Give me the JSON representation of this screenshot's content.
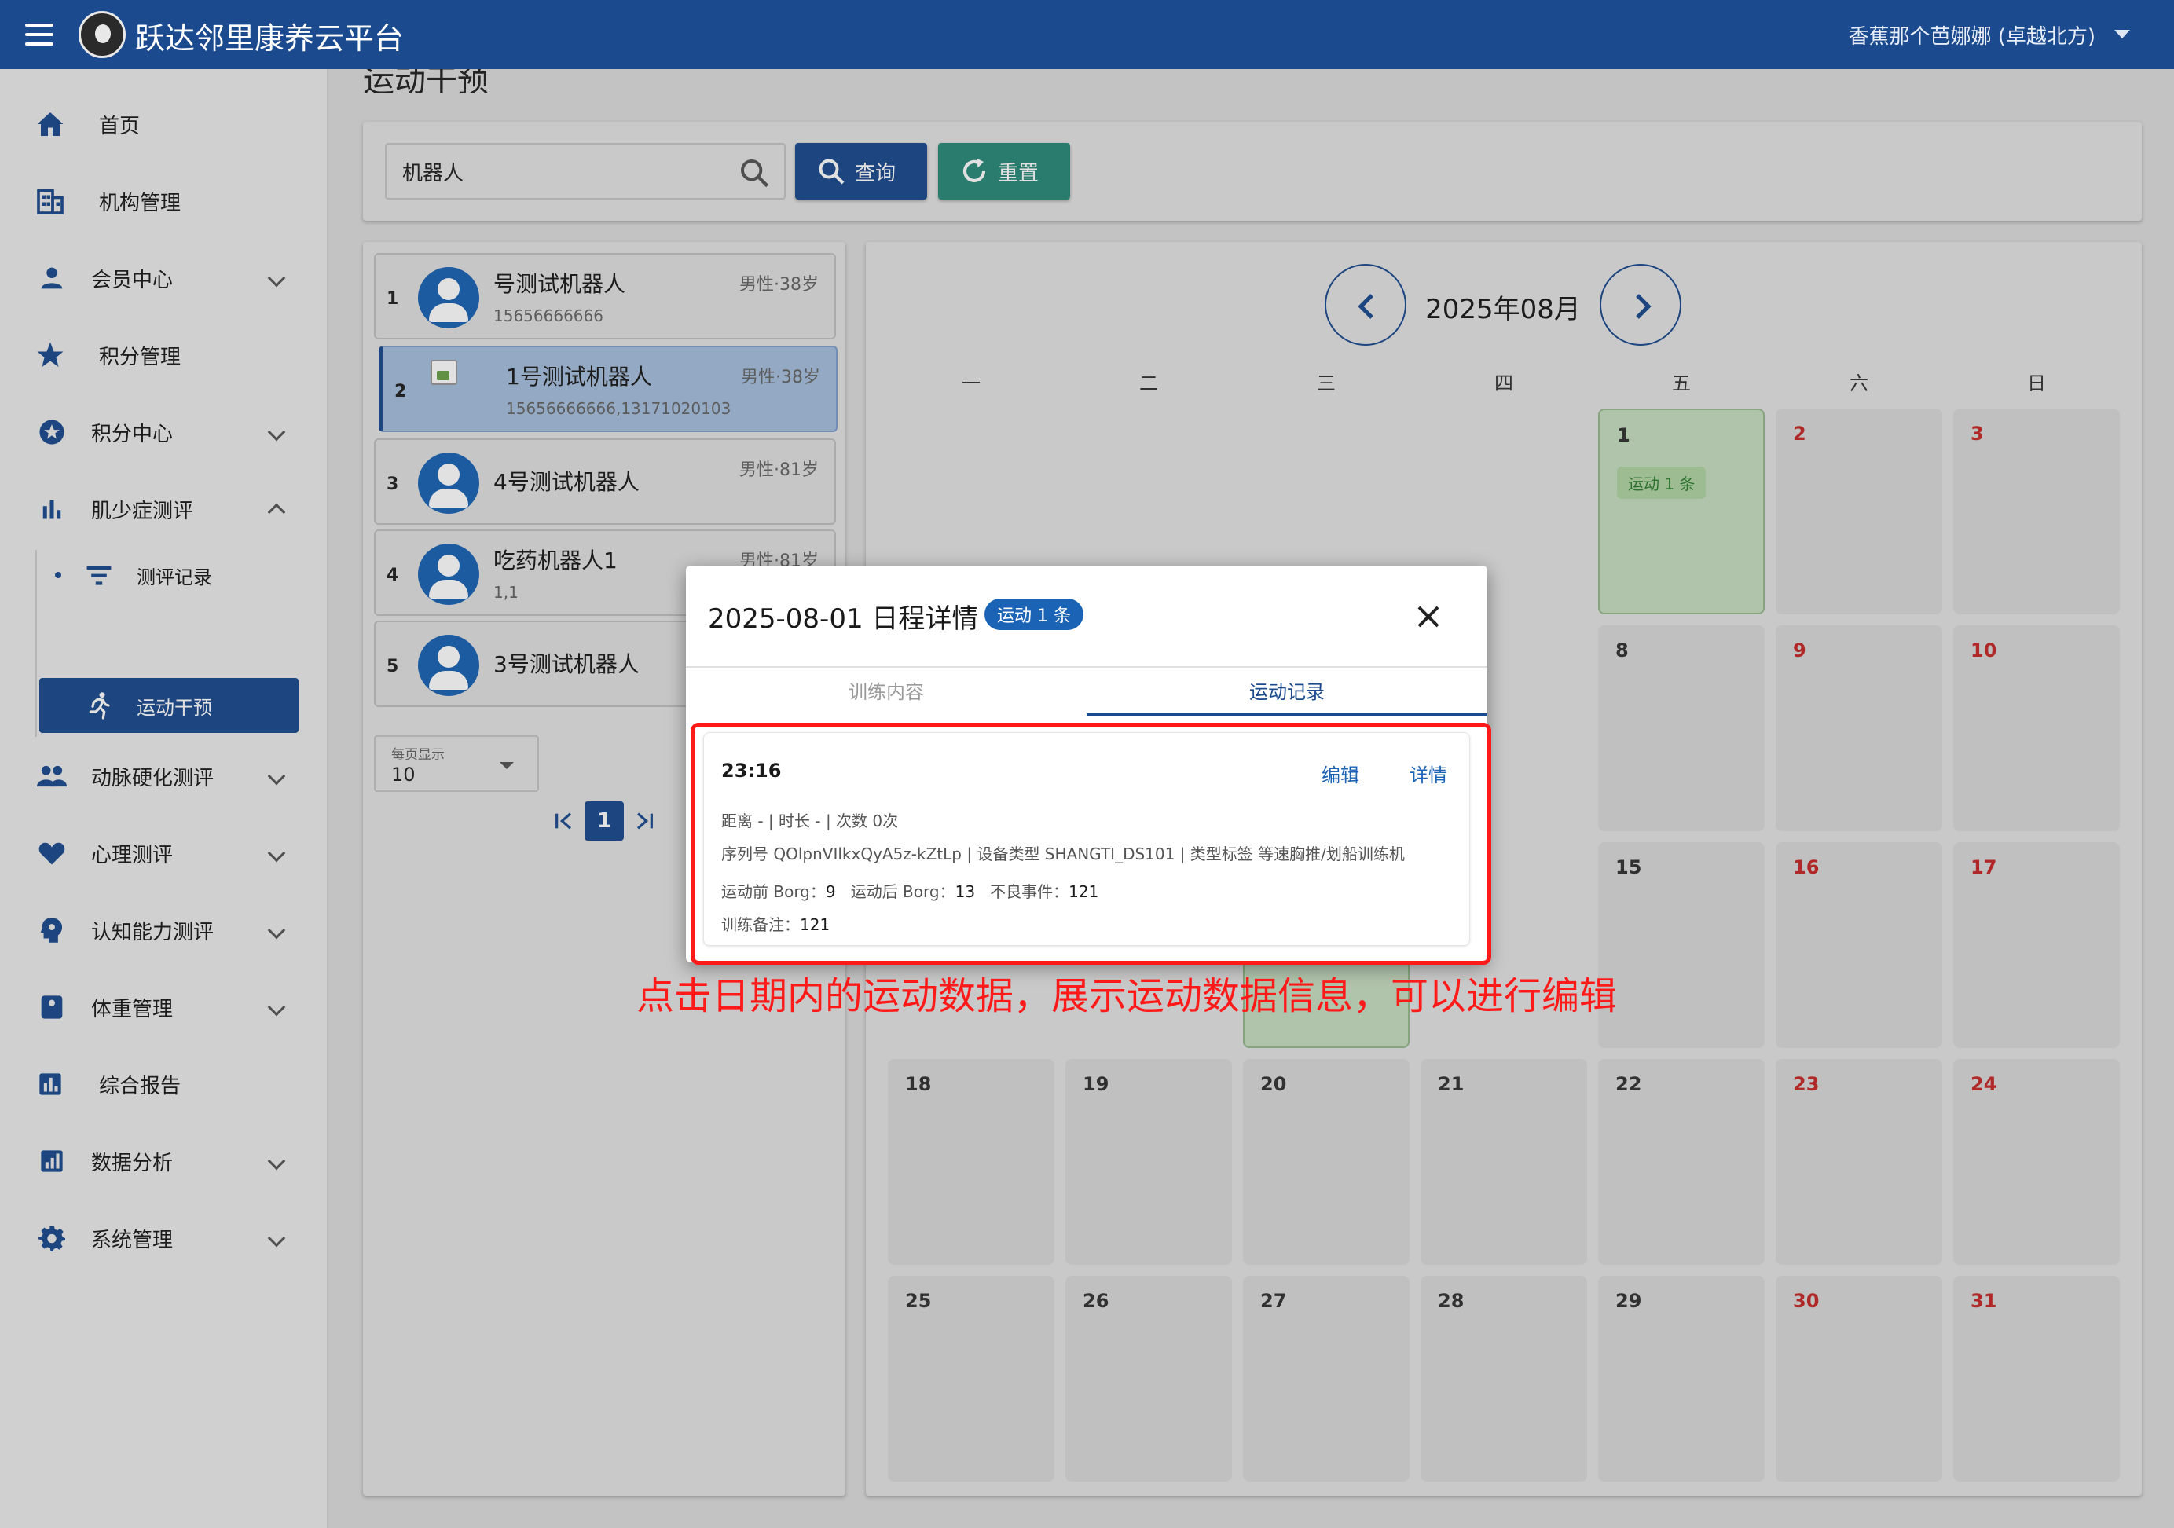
{
  "app": {
    "title": "跃达邻里康养云平台",
    "user": "香蕉那个芭娜娜 (卓越北方)"
  },
  "sidebar": {
    "items": [
      {
        "label": "首页",
        "icon": "home-icon"
      },
      {
        "label": "机构管理",
        "icon": "building-icon"
      },
      {
        "label": "会员中心",
        "icon": "person-icon"
      },
      {
        "label": "积分管理",
        "icon": "star-icon"
      },
      {
        "label": "积分中心",
        "icon": "star-circle-icon"
      },
      {
        "label": "肌少症测评",
        "icon": "bar-chart-icon"
      },
      {
        "label": "测评记录",
        "icon": "filter-icon"
      },
      {
        "label": "运动干预",
        "icon": "running-icon"
      },
      {
        "label": "动脉硬化测评",
        "icon": "people-icon"
      },
      {
        "label": "心理测评",
        "icon": "heart-icon"
      },
      {
        "label": "认知能力测评",
        "icon": "brain-icon"
      },
      {
        "label": "体重管理",
        "icon": "scale-icon"
      },
      {
        "label": "综合报告",
        "icon": "report-icon"
      },
      {
        "label": "数据分析",
        "icon": "analytics-icon"
      },
      {
        "label": "系统管理",
        "icon": "gear-icon"
      }
    ]
  },
  "main": {
    "heading": "运动干预"
  },
  "search": {
    "value": "机器人",
    "query_label": "查询",
    "reset_label": "重置"
  },
  "persons": [
    {
      "idx": "1",
      "name": "号测试机器人",
      "phone": "15656666666",
      "meta": "男性·38岁"
    },
    {
      "idx": "2",
      "name": "1号测试机器人",
      "phone": "15656666666,13171020103",
      "meta": "男性·38岁"
    },
    {
      "idx": "3",
      "name": "4号测试机器人",
      "phone": "",
      "meta": "男性·81岁"
    },
    {
      "idx": "4",
      "name": "吃药机器人1",
      "phone": "1,1",
      "meta": "男性·81岁"
    },
    {
      "idx": "5",
      "name": "3号测试机器人",
      "phone": "",
      "meta": ""
    }
  ],
  "pagination": {
    "per_page_label": "每页显示",
    "per_page_value": "10",
    "current": "1",
    "first": "|<",
    "last": ">|"
  },
  "calendar": {
    "title": "2025年08月",
    "weekdays": [
      "一",
      "二",
      "三",
      "四",
      "五",
      "六",
      "日"
    ],
    "days": [
      "1",
      "2",
      "3",
      "8",
      "9",
      "10",
      "15",
      "16",
      "17",
      "18",
      "19",
      "20",
      "21",
      "22",
      "23",
      "24",
      "25",
      "26",
      "27",
      "28",
      "29",
      "30",
      "31"
    ],
    "badge": "运动 1 条"
  },
  "dialog": {
    "title": "2025-08-01 日程详情",
    "badge": "运动 1 条",
    "tab1": "训练内容",
    "tab2": "运动记录",
    "record": {
      "time": "23:16",
      "edit": "编辑",
      "detail": "详情",
      "line1": "距离 -  |  时长 -  |  次数 0次",
      "line2": "序列号 QOlpnVIlkxQyA5z-kZtLp  |  设备类型 SHANGTI_DS101  |  类型标签 等速胸推/划船训练机",
      "borg_pre_label": "运动前 Borg：",
      "borg_pre": "9",
      "borg_post_label": "运动后 Borg：",
      "borg_post": "13",
      "adverse_label": "不良事件：",
      "adverse": "121",
      "remark_label": "训练备注：",
      "remark": "121"
    }
  },
  "annotation": "点击日期内的运动数据，展示运动数据信息，可以进行编辑",
  "colors": {
    "primary": "#1b4a8e",
    "reset": "#2b8a7a",
    "weekend": "#c62828",
    "highlight": "#ff1a1a"
  }
}
